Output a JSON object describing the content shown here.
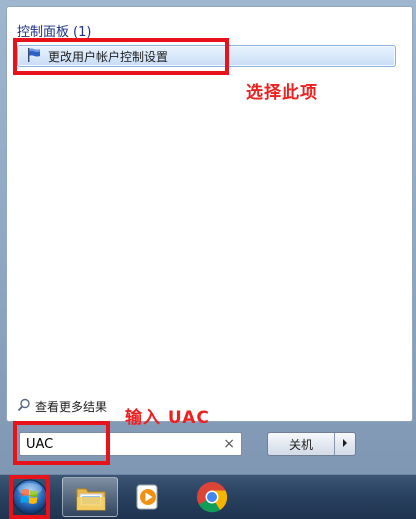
{
  "start_menu": {
    "group_header": {
      "title": "控制面板",
      "count": "(1)"
    },
    "results": [
      {
        "label": "更改用户帐户控制设置",
        "icon": "uac-flag-icon"
      }
    ],
    "see_more_label": "查看更多结果",
    "search": {
      "value": "UAC",
      "clear_glyph": "×"
    },
    "shutdown": {
      "label": "关机",
      "arrow_icon": "chevron-right-icon"
    }
  },
  "annotations": {
    "select_hint": "选择此项",
    "input_hint": "输入 UAC",
    "color": "#e8121a"
  },
  "taskbar": {
    "items": [
      {
        "name": "start-orb",
        "icon": "windows-orb-icon"
      },
      {
        "name": "explorer",
        "icon": "folder-icon"
      },
      {
        "name": "media-player",
        "icon": "media-player-icon"
      },
      {
        "name": "chrome",
        "icon": "chrome-icon"
      }
    ]
  }
}
